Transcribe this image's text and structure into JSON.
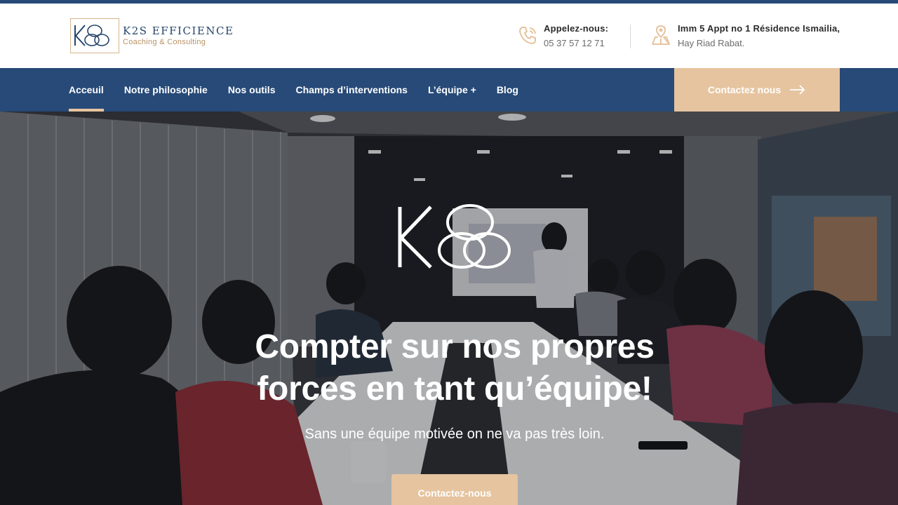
{
  "brand": {
    "name": "K2S EFFICIENCE",
    "tagline": "Coaching & Consulting",
    "accent_color": "#e6c49f",
    "primary_color": "#274a78"
  },
  "header": {
    "phone": {
      "icon": "phone-icon",
      "title": "Appelez-nous:",
      "value": "05 37 57 12 71"
    },
    "address": {
      "icon": "map-pin-icon",
      "line1": "Imm 5 Appt no 1 Résidence Ismailia,",
      "line2": "Hay Riad Rabat."
    }
  },
  "nav": {
    "items": [
      {
        "label": "Acceuil",
        "active": true
      },
      {
        "label": "Notre philosophie"
      },
      {
        "label": "Nos outils"
      },
      {
        "label": "Champs d’interventions"
      },
      {
        "label": "L’équipe +"
      },
      {
        "label": "Blog"
      }
    ],
    "cta_label": "Contactez nous",
    "cta_icon": "arrow-right-icon"
  },
  "hero": {
    "logo_icon": "k2s-logo-icon",
    "title_line1": "Compter sur nos propres",
    "title_line2": "forces en tant qu’équipe!",
    "subtitle": "Sans une équipe motivée on ne va pas très loin.",
    "button_label": "Contactez-nous"
  }
}
